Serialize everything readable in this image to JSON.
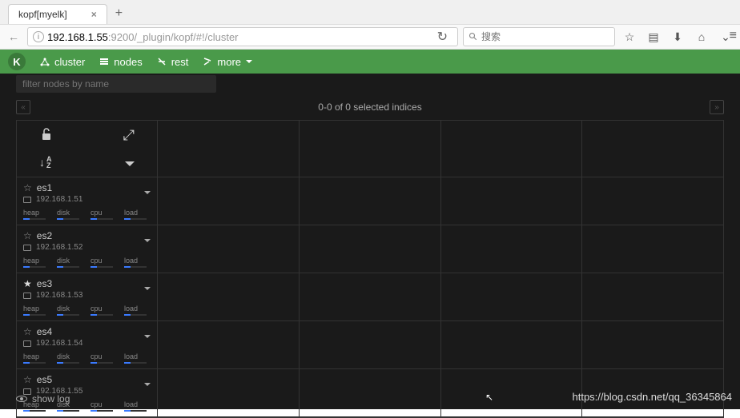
{
  "browser": {
    "tab_title": "kopf[myelk]",
    "url_host": "192.168.1.55",
    "url_rest": ":9200/_plugin/kopf/#!/cluster",
    "search_placeholder": "搜索"
  },
  "topbar": {
    "logo": "K",
    "menu": {
      "cluster": "cluster",
      "nodes": "nodes",
      "rest": "rest",
      "more": "more"
    }
  },
  "filter_placeholder": "filter nodes by name",
  "indices_status": "0-0 of 0 selected indices",
  "header_sort": {
    "arrow": "↓",
    "az": "A\nZ"
  },
  "metrics_labels": {
    "heap": "heap",
    "disk": "disk",
    "cpu": "cpu",
    "load": "load"
  },
  "nodes": [
    {
      "name": "es1",
      "ip": "192.168.1.51",
      "master": false
    },
    {
      "name": "es2",
      "ip": "192.168.1.52",
      "master": false
    },
    {
      "name": "es3",
      "ip": "192.168.1.53",
      "master": true
    },
    {
      "name": "es4",
      "ip": "192.168.1.54",
      "master": false
    },
    {
      "name": "es5",
      "ip": "192.168.1.55",
      "master": false
    }
  ],
  "show_log": "show log",
  "watermark": "https://blog.csdn.net/qq_36345864"
}
